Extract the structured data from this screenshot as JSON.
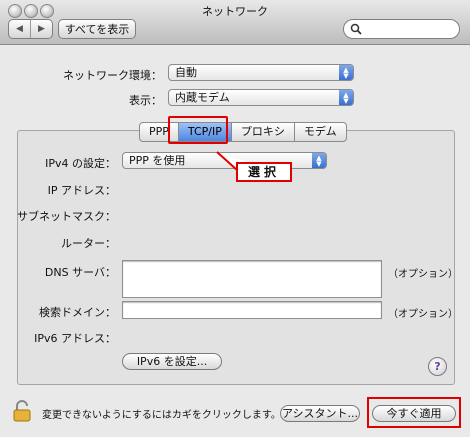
{
  "window": {
    "title": "ネットワーク"
  },
  "toolbar": {
    "back": "◀",
    "forward": "▶",
    "show_all": "すべてを表示",
    "search_value": ""
  },
  "location": {
    "label": "ネットワーク環境：",
    "value": "自動"
  },
  "show": {
    "label": "表示：",
    "value": "内蔵モデム"
  },
  "tabs": [
    {
      "label": "PPP",
      "active": false
    },
    {
      "label": "TCP/IP",
      "active": true
    },
    {
      "label": "プロキシ",
      "active": false
    },
    {
      "label": "モデム",
      "active": false
    }
  ],
  "callout": {
    "text": "選択"
  },
  "ipv4": {
    "label": "IPv4 の設定：",
    "value": "PPP を使用"
  },
  "fields": {
    "ip_address": {
      "label": "IP アドレス：",
      "value": ""
    },
    "subnet": {
      "label": "サブネットマスク：",
      "value": ""
    },
    "router": {
      "label": "ルーター：",
      "value": ""
    },
    "dns": {
      "label": "DNS サーバ：",
      "value": "",
      "note": "（オプション）"
    },
    "search_domain": {
      "label": "検索ドメイン：",
      "value": "",
      "note": "（オプション）"
    },
    "ipv6_address": {
      "label": "IPv6 アドレス：",
      "value": ""
    }
  },
  "ipv6_button": "IPv6 を設定...",
  "help": "?",
  "lock_text": "変更できないようにするにはカギをクリックします。",
  "assistant_button": "アシスタント...",
  "apply_button": "今すぐ適用",
  "colors": {
    "highlight": "#e00000",
    "tab_active": "#4d86e0"
  }
}
